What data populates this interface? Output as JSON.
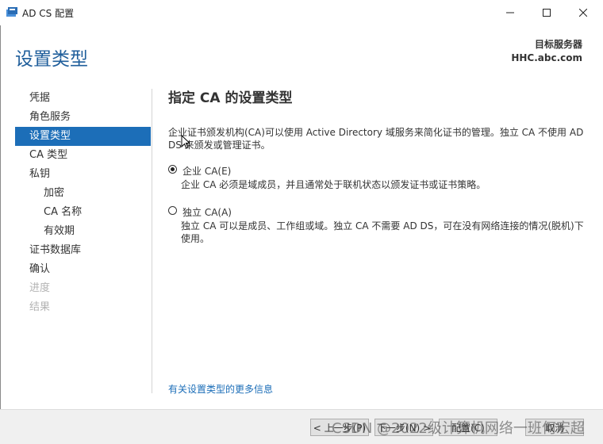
{
  "window": {
    "title": "AD CS 配置"
  },
  "header": {
    "page_title": "设置类型",
    "target_label": "目标服务器",
    "target_value": "HHC.abc.com"
  },
  "sidebar": {
    "items": [
      {
        "label": "凭据",
        "state": "normal"
      },
      {
        "label": "角色服务",
        "state": "normal"
      },
      {
        "label": "设置类型",
        "state": "active"
      },
      {
        "label": "CA 类型",
        "state": "normal"
      },
      {
        "label": "私钥",
        "state": "normal"
      },
      {
        "label": "加密",
        "state": "sub"
      },
      {
        "label": "CA 名称",
        "state": "sub"
      },
      {
        "label": "有效期",
        "state": "sub"
      },
      {
        "label": "证书数据库",
        "state": "normal"
      },
      {
        "label": "确认",
        "state": "normal"
      },
      {
        "label": "进度",
        "state": "disabled"
      },
      {
        "label": "结果",
        "state": "disabled"
      }
    ]
  },
  "main": {
    "section_title": "指定 CA 的设置类型",
    "description": "企业证书颁发机构(CA)可以使用 Active Directory 域服务来简化证书的管理。独立 CA 不使用 AD DS 来颁发或管理证书。",
    "options": [
      {
        "label": "企业 CA(E)",
        "checked": true,
        "description": "企业 CA 必须是域成员，并且通常处于联机状态以颁发证书或证书策略。"
      },
      {
        "label": "独立 CA(A)",
        "checked": false,
        "description": "独立 CA 可以是成员、工作组或域。独立 CA 不需要 AD DS，可在没有网络连接的情况(脱机)下使用。"
      }
    ],
    "more_link": "有关设置类型的更多信息"
  },
  "footer": {
    "prev_label": "< 上一步(P)",
    "next_label": "下一步(N) >",
    "config_label": "配置(C)",
    "cancel_label": "取消"
  },
  "watermark": "CSDN @2022级计算机网络一班何宏超",
  "colors": {
    "accent": "#1c6eb8",
    "title": "#1f5e9b"
  }
}
